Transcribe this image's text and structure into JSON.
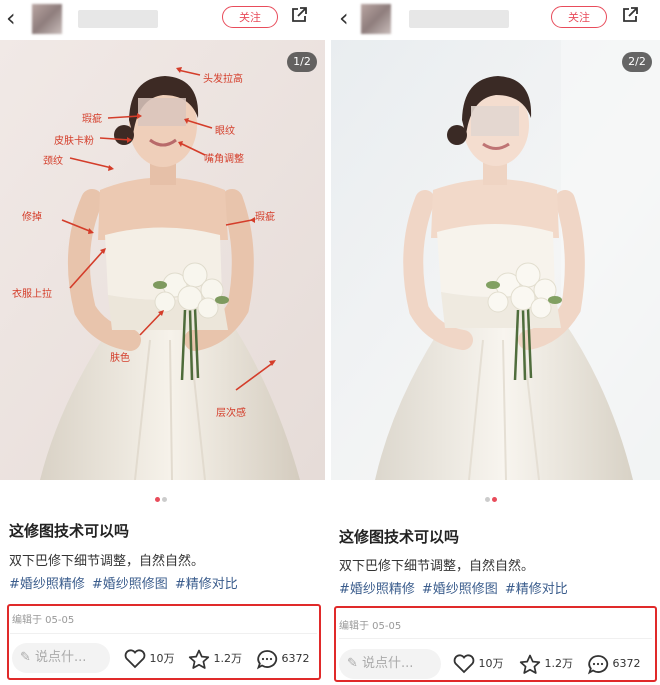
{
  "left": {
    "follow_label": "关注",
    "image_counter": "1/2",
    "annotations": [
      "头发拉高",
      "瑕疵",
      "眼纹",
      "皮肤卡粉",
      "嘴角调整",
      "颈纹",
      "修掉",
      "瑕疵",
      "衣服上拉",
      "肤色",
      "层次感"
    ],
    "title": "这修图技术可以吗",
    "description": "双下巴修下细节调整，自然自然。",
    "tags": [
      "#婚纱照精修",
      "#婚纱照修图",
      "#精修对比"
    ],
    "edited": "编辑于 05-05",
    "comment_placeholder": "说点什...",
    "likes": "10万",
    "favorites": "1.2万",
    "comments": "6372"
  },
  "right": {
    "follow_label": "关注",
    "image_counter": "2/2",
    "title": "这修图技术可以吗",
    "description": "双下巴修下细节调整，自然自然。",
    "tags": [
      "#婚纱照精修",
      "#婚纱照修图",
      "#精修对比"
    ],
    "edited": "编辑于 05-05",
    "comment_placeholder": "说点什...",
    "likes": "10万",
    "favorites": "1.2万",
    "comments": "6372"
  },
  "colors": {
    "accent": "#e84c5b",
    "highlight_box": "#e02a2a",
    "tag": "#3a5c8c",
    "annotation": "#d43d2a"
  }
}
